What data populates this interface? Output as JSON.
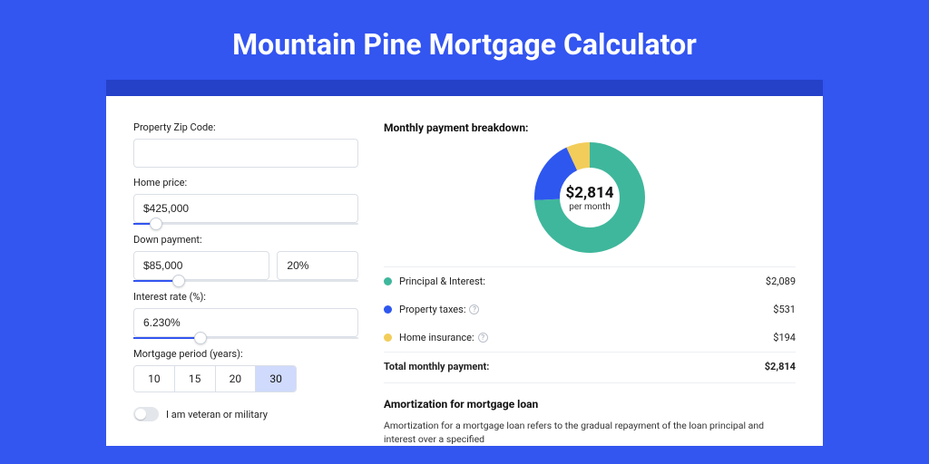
{
  "header": {
    "title": "Mountain Pine Mortgage Calculator"
  },
  "form": {
    "zip": {
      "label": "Property Zip Code:",
      "value": ""
    },
    "price": {
      "label": "Home price:",
      "value": "$425,000",
      "slider_pct": 10
    },
    "down": {
      "label": "Down payment:",
      "amount": "$85,000",
      "pct": "20%",
      "slider_pct": 20
    },
    "rate": {
      "label": "Interest rate (%):",
      "value": "6.230%",
      "slider_pct": 30
    },
    "period": {
      "label": "Mortgage period (years):",
      "options": [
        "10",
        "15",
        "20",
        "30"
      ],
      "selected": "30"
    },
    "military": {
      "label": "I am veteran or military",
      "on": false
    }
  },
  "breakdown": {
    "title": "Monthly payment breakdown:",
    "total_display": "$2,814",
    "subtitle": "per month",
    "items": [
      {
        "name": "Principal & Interest:",
        "amount": "$2,089",
        "color": "#3fb79c",
        "has_info": false
      },
      {
        "name": "Property taxes:",
        "amount": "$531",
        "color": "#2e57ef",
        "has_info": true
      },
      {
        "name": "Home insurance:",
        "amount": "$194",
        "color": "#f2cd5a",
        "has_info": true
      }
    ],
    "total_label": "Total monthly payment:",
    "total_amount": "$2,814"
  },
  "chart_data": {
    "type": "pie",
    "title": "Monthly payment breakdown",
    "series": [
      {
        "name": "Principal & Interest",
        "value": 2089,
        "color": "#3fb79c"
      },
      {
        "name": "Property taxes",
        "value": 531,
        "color": "#2e57ef"
      },
      {
        "name": "Home insurance",
        "value": 194,
        "color": "#f2cd5a"
      }
    ],
    "center_label": "$2,814",
    "center_sublabel": "per month"
  },
  "amortization": {
    "title": "Amortization for mortgage loan",
    "body_preview": "Amortization for a mortgage loan refers to the gradual repayment of the loan principal and interest over a specified"
  }
}
